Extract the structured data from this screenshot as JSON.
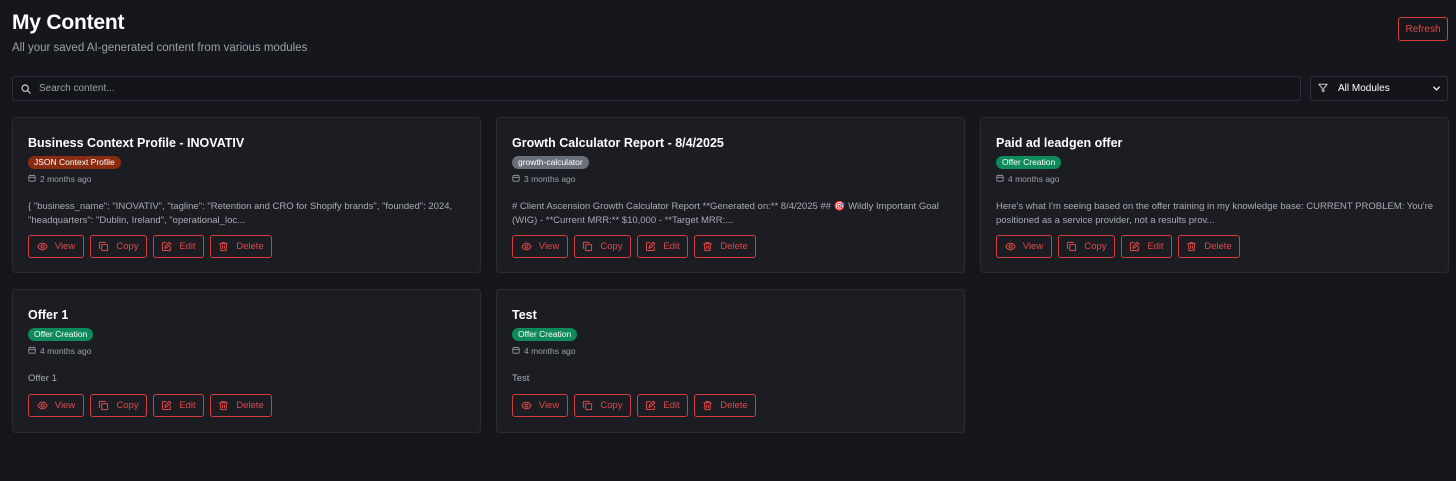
{
  "header": {
    "title": "My Content",
    "subtitle": "All your saved AI-generated content from various modules",
    "refresh_label": "Refresh"
  },
  "search": {
    "placeholder": "Search content...",
    "value": ""
  },
  "filter": {
    "selected": "All Modules"
  },
  "action_labels": {
    "view": "View",
    "copy": "Copy",
    "edit": "Edit",
    "delete": "Delete"
  },
  "colors": {
    "accent_red": "#e04848",
    "badge_json": "#8a2c12",
    "badge_growth": "#6a707a",
    "badge_offer": "#0f8a5a"
  },
  "cards": [
    {
      "title": "Business Context Profile - INOVATIV",
      "badge": "JSON Context Profile",
      "badge_color": "#8a2c12",
      "time": "2 months ago",
      "preview": "{ \"business_name\": \"INOVATIV\", \"tagline\": \"Retention and CRO for Shopify brands\", \"founded\": 2024, \"headquarters\": \"Dublin, Ireland\", \"operational_loc..."
    },
    {
      "title": "Growth Calculator Report - 8/4/2025",
      "badge": "growth-calculator",
      "badge_color": "#6a707a",
      "time": "3 months ago",
      "preview": "# Client Ascension Growth Calculator Report **Generated on:** 8/4/2025 ## 🎯 Wildly Important Goal (WIG) - **Current MRR:** $10,000 - **Target MRR:..."
    },
    {
      "title": "Paid ad leadgen offer",
      "badge": "Offer Creation",
      "badge_color": "#0f8a5a",
      "time": "4 months ago",
      "preview": "Here's what I'm seeing based on the offer training in my knowledge base: CURRENT PROBLEM: You're positioned as a service provider, not a results prov..."
    },
    {
      "title": "Offer 1",
      "badge": "Offer Creation",
      "badge_color": "#0f8a5a",
      "time": "4 months ago",
      "preview": "Offer 1"
    },
    {
      "title": "Test",
      "badge": "Offer Creation",
      "badge_color": "#0f8a5a",
      "time": "4 months ago",
      "preview": "Test"
    }
  ]
}
